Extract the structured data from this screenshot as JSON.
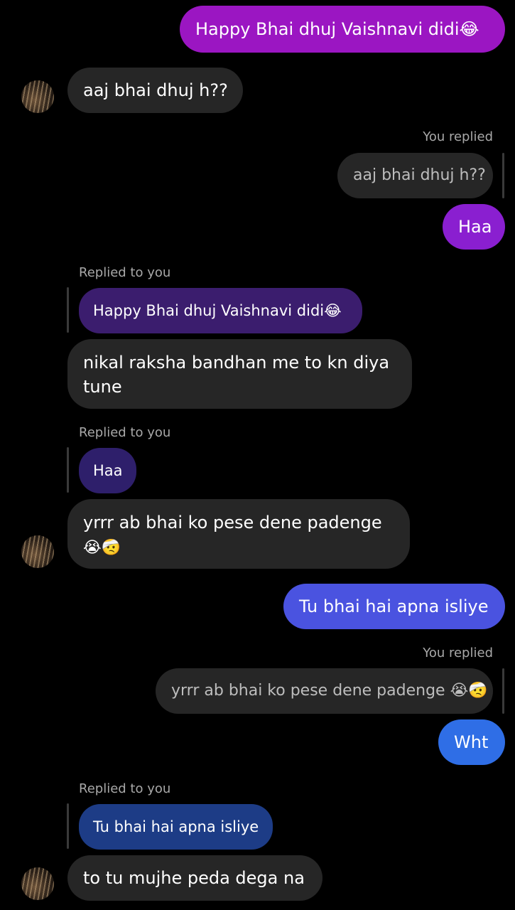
{
  "messages": {
    "m1": {
      "text": "Happy Bhai dhuj Vaishnavi didi😂",
      "color": "#9b16c2"
    },
    "m2": {
      "text": "aaj bhai dhuj h??"
    },
    "m3": {
      "label": "You replied",
      "quote": "aaj bhai dhuj h??"
    },
    "m4": {
      "text": "Haa",
      "color": "#8a1fd0"
    },
    "m5": {
      "label": "Replied to you",
      "quote": "Happy Bhai dhuj Vaishnavi didi😂",
      "quote_color": "#3b1d6e",
      "line1": "nikal raksha bandhan me to kn diya",
      "line2": "tune"
    },
    "m6": {
      "label": "Replied to you",
      "quote": "Haa",
      "quote_color": "#2e1f6b",
      "line1": "yrrr ab bhai ko pese dene padenge",
      "emoji": "😭🤕"
    },
    "m7": {
      "text": "Tu bhai hai apna isliye",
      "color": "#4a53e0"
    },
    "m8": {
      "label": "You replied",
      "quote": "yrrr ab bhai ko pese dene padenge 😭🤕"
    },
    "m9": {
      "text": "Wht",
      "color": "#2f6ee6"
    },
    "m10": {
      "label": "Replied to you",
      "quote": "Tu bhai hai apna isliye",
      "quote_color": "#1d3c86",
      "text": "to tu mujhe peda dega na"
    }
  },
  "icons": {
    "avatar": "avatar-photo"
  }
}
